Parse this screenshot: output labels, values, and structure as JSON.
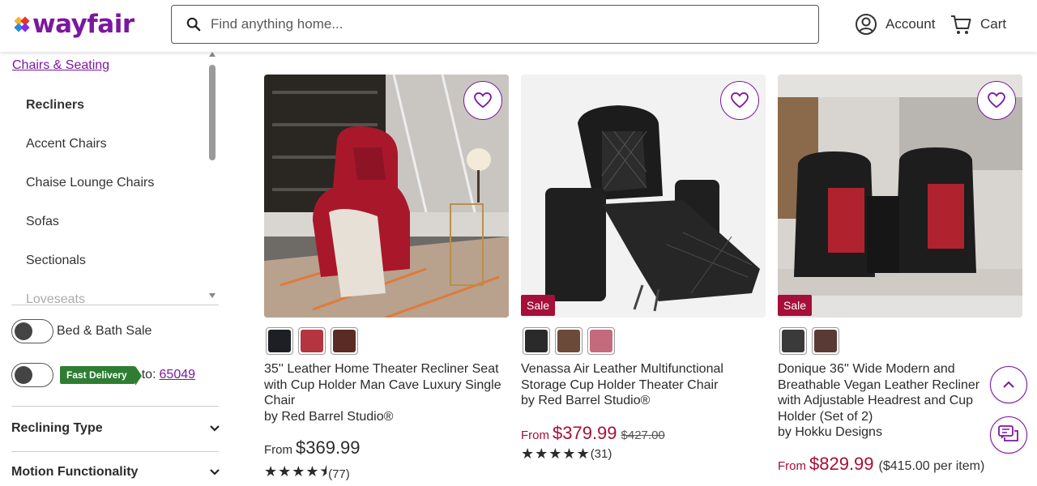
{
  "header": {
    "logo": "wayfair",
    "search_placeholder": "Find anything home...",
    "account_label": "Account",
    "cart_label": "Cart"
  },
  "sidebar": {
    "category_link": "Chairs & Seating",
    "categories": [
      {
        "label": "Recliners"
      },
      {
        "label": "Accent Chairs"
      },
      {
        "label": "Chaise Lounge Chairs"
      },
      {
        "label": "Sofas"
      },
      {
        "label": "Sectionals"
      },
      {
        "label": "Loveseats"
      }
    ],
    "bed_bath_toggle_label": "Bed & Bath Sale",
    "fast_delivery_badge": "Fast Delivery",
    "delivery_to_label": "to:",
    "delivery_zip": "65049",
    "facets": [
      {
        "label": "Reclining Type"
      },
      {
        "label": "Motion Functionality"
      }
    ]
  },
  "products": [
    {
      "title": "35'' Leather Home Theater Recliner Seat with Cup Holder Man Cave Luxury Single Chair",
      "brand": "by Red Barrel Studio®",
      "price_prefix": "From",
      "price": "$369.99",
      "review_count": "(77)",
      "rating": 4.5,
      "sale_badge": "",
      "swatch_colors": [
        "#1d1f24",
        "#b4343f",
        "#5a2a24"
      ]
    },
    {
      "title": "Venassa Air Leather Multifunctional Storage Cup Holder Theater Chair",
      "brand": "by Red Barrel Studio®",
      "price_prefix": "From",
      "price": "$379.99",
      "was_price": "$427.00",
      "review_count": "(31)",
      "rating": 5,
      "sale_badge": "Sale",
      "swatch_colors": [
        "#2a2a2a",
        "#6b4a3a",
        "#c36a7c"
      ]
    },
    {
      "title": "Donique 36'' Wide Modern and Breathable Vegan Leather Recliner with Adjustable Headrest and Cup Holder (Set of 2)",
      "brand": "by Hokku Designs",
      "price_prefix": "From",
      "price": "$829.99",
      "per_item": "($415.00 per item)",
      "sale_badge": "Sale",
      "swatch_colors": [
        "#3a3a3a",
        "#5a3a34"
      ]
    }
  ],
  "colors": {
    "brand_purple": "#7b189f",
    "sale_red": "#a50f39",
    "fast_green": "#2e7d32"
  }
}
